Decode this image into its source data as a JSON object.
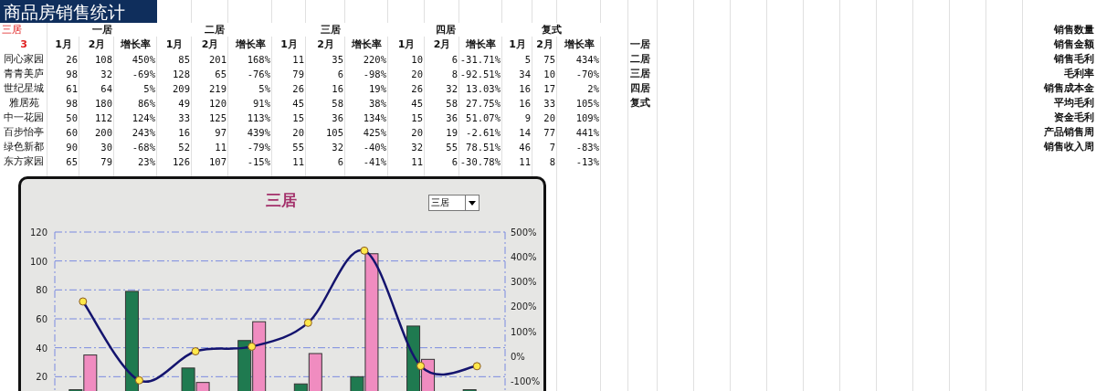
{
  "sheet": {
    "title": "商品房销售统计",
    "selector_cell": "三居",
    "index_cell": "3",
    "groups": [
      {
        "label": "一居",
        "columns": [
          "1月",
          "2月",
          "增长率"
        ]
      },
      {
        "label": "二居",
        "columns": [
          "1月",
          "2月",
          "增长率"
        ]
      },
      {
        "label": "三居",
        "columns": [
          "1月",
          "2月",
          "增长率"
        ]
      },
      {
        "label": "四居",
        "columns": [
          "1月",
          "2月",
          "增长率"
        ]
      },
      {
        "label": "复式",
        "columns": [
          "1月",
          "2月",
          "增长率"
        ]
      }
    ],
    "rows": [
      {
        "name": "同心家园",
        "values": [
          "26",
          "108",
          "450%",
          "85",
          "201",
          "168%",
          "11",
          "35",
          "220%",
          "10",
          "6",
          "-31.71%",
          "5",
          "75",
          "434%"
        ]
      },
      {
        "name": "青青美庐",
        "values": [
          "98",
          "32",
          "-69%",
          "128",
          "65",
          "-76%",
          "79",
          "6",
          "-98%",
          "20",
          "8",
          "-92.51%",
          "34",
          "10",
          "-70%"
        ]
      },
      {
        "name": "世纪星城",
        "values": [
          "61",
          "64",
          "5%",
          "209",
          "219",
          "5%",
          "26",
          "16",
          "19%",
          "26",
          "32",
          "13.03%",
          "16",
          "17",
          "2%"
        ]
      },
      {
        "name": "雅居苑",
        "values": [
          "98",
          "180",
          "86%",
          "49",
          "120",
          "91%",
          "45",
          "58",
          "38%",
          "45",
          "58",
          "27.75%",
          "16",
          "33",
          "105%"
        ]
      },
      {
        "name": "中一花园",
        "values": [
          "50",
          "112",
          "124%",
          "33",
          "125",
          "113%",
          "15",
          "36",
          "134%",
          "15",
          "36",
          "51.07%",
          "9",
          "20",
          "109%"
        ]
      },
      {
        "name": "百步怡亭",
        "values": [
          "60",
          "200",
          "243%",
          "16",
          "97",
          "439%",
          "20",
          "105",
          "425%",
          "20",
          "19",
          "-2.61%",
          "14",
          "77",
          "441%"
        ]
      },
      {
        "name": "绿色新都",
        "values": [
          "90",
          "30",
          "-68%",
          "52",
          "11",
          "-79%",
          "55",
          "32",
          "-40%",
          "32",
          "55",
          "78.51%",
          "46",
          "7",
          "-83%"
        ]
      },
      {
        "name": "东方家园",
        "values": [
          "65",
          "79",
          "23%",
          "126",
          "107",
          "-15%",
          "11",
          "6",
          "-41%",
          "11",
          "6",
          "-30.78%",
          "11",
          "8",
          "-13%"
        ]
      }
    ],
    "side_list": [
      "一居",
      "二居",
      "三居",
      "四居",
      "复式"
    ],
    "right_labels": [
      "销售数量",
      "销售金额",
      "销售毛利",
      "毛利率",
      "销售成本金",
      "平均毛利",
      "资金毛利",
      "产品销售周",
      "销售收入周"
    ]
  },
  "chart": {
    "dropdown": {
      "value": "三居"
    },
    "chart_data": {
      "type": "bar",
      "title": "三居",
      "grid": true,
      "ylim": [
        0,
        120
      ],
      "yticks": [
        20,
        40,
        60,
        80,
        100,
        120
      ],
      "y2lim": [
        -200,
        500
      ],
      "y2ticks": [
        {
          "value": 500,
          "label": "500%"
        },
        {
          "value": 400,
          "label": "400%"
        },
        {
          "value": 300,
          "label": "300%"
        },
        {
          "value": 200,
          "label": "200%"
        },
        {
          "value": 100,
          "label": "100%"
        },
        {
          "value": 0,
          "label": "0%"
        },
        {
          "value": -100,
          "label": "-100%"
        }
      ],
      "series": [
        {
          "type": "bar",
          "color": "#1f7a50",
          "values": [
            11,
            79,
            26,
            45,
            15,
            20,
            55,
            11
          ]
        },
        {
          "type": "bar",
          "color": "#f08cc0",
          "values": [
            35,
            null,
            16,
            58,
            36,
            105,
            32,
            null
          ]
        },
        {
          "type": "line",
          "axis": "y2",
          "marker": "circle",
          "color": "#14146e",
          "values": [
            220,
            -98,
            19,
            38,
            134,
            425,
            -40,
            -41
          ]
        }
      ]
    }
  }
}
